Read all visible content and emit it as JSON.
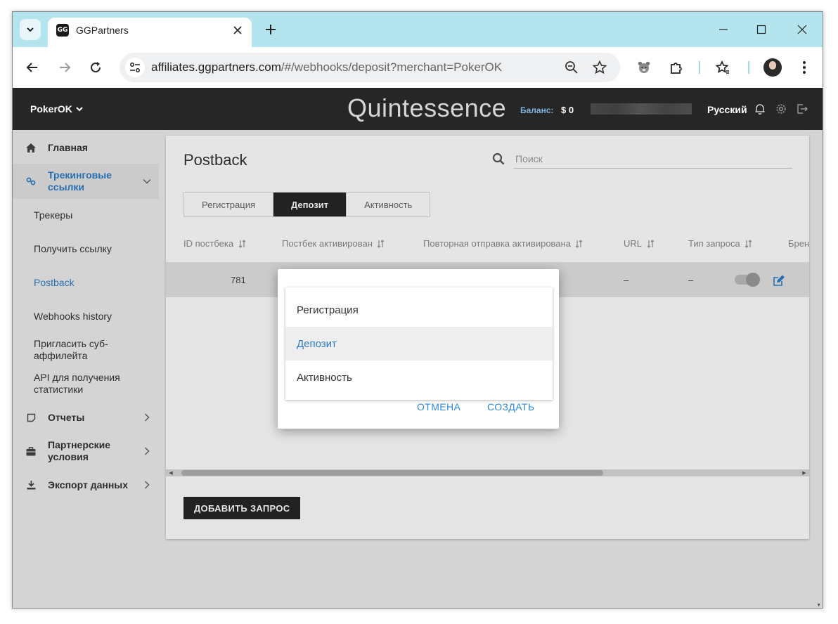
{
  "browser": {
    "tab_title": "GGPartners",
    "favicon_text": "GG",
    "url_host": "affiliates.ggpartners.com",
    "url_path": "/#/webhooks/deposit?merchant=PokerOK"
  },
  "header": {
    "merchant": "PokerOK",
    "brand": "Quintessence",
    "balance_label": "Баланс:",
    "balance_value": "$ 0",
    "language": "Русский"
  },
  "sidebar": {
    "main": "Главная",
    "tracking": "Трекинговые ссылки",
    "sub": {
      "trackers": "Трекеры",
      "get_link": "Получить ссылку",
      "postback": "Postback",
      "webhooks_history": "Webhooks history",
      "invite": "Пригласить суб-аффилейта",
      "api": "API для получения статистики"
    },
    "reports": "Отчеты",
    "partner_terms": "Партнерские условия",
    "export": "Экспорт данных"
  },
  "main": {
    "title": "Postback",
    "search_placeholder": "Поиск",
    "tabs": [
      "Регистрация",
      "Депозит",
      "Активность"
    ],
    "active_tab": "Депозит",
    "columns": [
      "ID постбека",
      "Постбек активирован",
      "Повторная отправка активирована",
      "URL",
      "Тип запроса",
      "Брен"
    ],
    "row": {
      "id": "781",
      "url": "–",
      "request_type": "–"
    },
    "add_button": "ДОБАВИТЬ ЗАПРОС"
  },
  "dialog": {
    "options": [
      "Регистрация",
      "Депозит",
      "Активность"
    ],
    "highlighted": "Депозит",
    "cancel": "ОТМЕНА",
    "create": "СОЗДАТЬ"
  }
}
